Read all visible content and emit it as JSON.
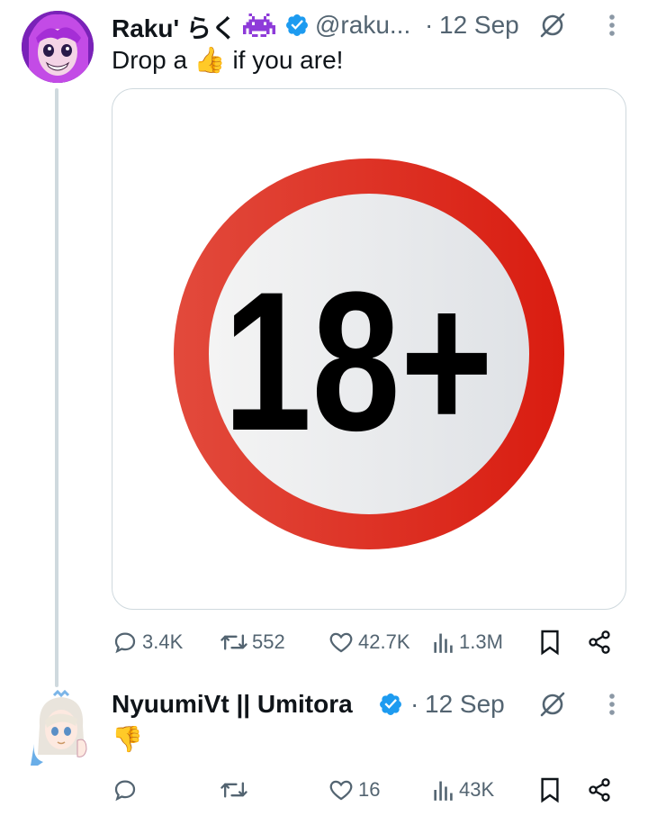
{
  "tweet1": {
    "name": "Raku' らく",
    "handle": "@raku...",
    "separator": "·",
    "date": "12 Sep",
    "text": "Drop a 👍 if you are!",
    "image_text": "18+",
    "stats": {
      "replies": "3.4K",
      "retweets": "552",
      "likes": "42.7K",
      "views": "1.3M"
    }
  },
  "tweet2": {
    "name": "NyuumiVt || Umitora",
    "separator": "·",
    "date": "12 Sep",
    "text": "👎",
    "stats": {
      "replies": "",
      "retweets": "",
      "likes": "16",
      "views": "43K"
    }
  },
  "colors": {
    "verified": "#1d9bf0",
    "muted": "#536471",
    "ring": "#e03128",
    "thread": "#cfd9de"
  },
  "icons": [
    "verified-badge-icon",
    "grok-icon",
    "more-icon",
    "reply-icon",
    "retweet-icon",
    "like-icon",
    "views-icon",
    "bookmark-icon",
    "share-icon",
    "space-invader-icon"
  ]
}
